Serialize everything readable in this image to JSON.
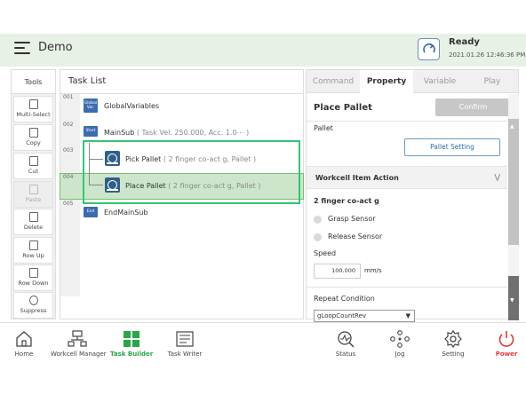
{
  "header": {
    "app_title": "Demo",
    "status_label": "Ready",
    "status_time": "2021.01.26 12:46:36 PM"
  },
  "tools": {
    "title": "Tools",
    "items": [
      {
        "label": "Multi-Select",
        "enabled": true
      },
      {
        "label": "Copy",
        "enabled": true
      },
      {
        "label": "Cut",
        "enabled": true
      },
      {
        "label": "Paste",
        "enabled": false
      },
      {
        "label": "Delete",
        "enabled": true
      },
      {
        "label": "Row Up",
        "enabled": true
      },
      {
        "label": "Row Down",
        "enabled": true
      },
      {
        "label": "Suppress",
        "enabled": true
      }
    ]
  },
  "task_list": {
    "title": "Task List",
    "rows": [
      {
        "num": "001",
        "badge": "Global Var.",
        "text": "GlobalVariables",
        "sub": ""
      },
      {
        "num": "002",
        "badge": "Start",
        "text": "MainSub",
        "sub": "( Task Vel. 250.000, Acc. 1.0⋯ )"
      },
      {
        "num": "003",
        "badge": "",
        "text": "Pick Pallet",
        "sub": "( 2 finger co-act g, Pallet )"
      },
      {
        "num": "004",
        "badge": "",
        "text": "Place Pallet",
        "sub": "( 2 finger co-act g, Pallet )"
      },
      {
        "num": "005",
        "badge": "End",
        "text": "EndMainSub",
        "sub": ""
      }
    ]
  },
  "panel": {
    "tabs": [
      "Command",
      "Property",
      "Variable",
      "Play"
    ],
    "active_tab": "Property",
    "title": "Place Pallet",
    "confirm_label": "Confirm",
    "pallet_label": "Pallet",
    "pallet_button": "Pallet Setting",
    "section_title": "Workcell Item Action",
    "item_name": "2 finger co-act g",
    "options": [
      "Grasp Sensor",
      "Release Sensor"
    ],
    "speed_label": "Speed",
    "speed_value": "100.000",
    "speed_unit": "mm/s",
    "repeat_label": "Repeat Condition",
    "repeat_value": "gLoopCountRev"
  },
  "bottom_nav": [
    {
      "label": "Home",
      "icon": "home-icon"
    },
    {
      "label": "Workcell Manager",
      "icon": "workcell-icon"
    },
    {
      "label": "Task Builder",
      "icon": "task-builder-icon",
      "active": true
    },
    {
      "label": "Task Writer",
      "icon": "task-writer-icon"
    },
    {
      "label": "Status",
      "icon": "status-icon"
    },
    {
      "label": "Jog",
      "icon": "jog-icon"
    },
    {
      "label": "Setting",
      "icon": "gear-icon"
    },
    {
      "label": "Power",
      "icon": "power-icon"
    }
  ],
  "colors": {
    "header_bg": "#e8f1e6",
    "accent_green": "#2ec873",
    "task_badge_blue": "#3b6cb1",
    "power_red": "#e53935"
  }
}
